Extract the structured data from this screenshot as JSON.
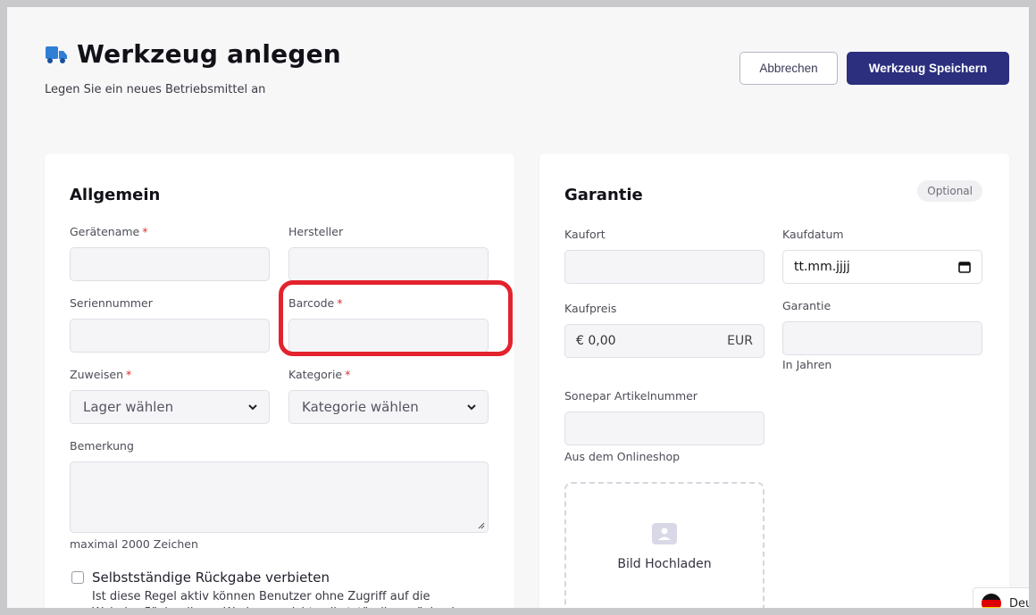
{
  "header": {
    "title": "Werkzeug anlegen",
    "subtitle": "Legen Sie ein neues Betriebsmittel an",
    "cancel_label": "Abbrechen",
    "save_label": "Werkzeug Speichern",
    "accent_color": "#2b2f7d",
    "icon": "truck-icon"
  },
  "general": {
    "title": "Allgemein",
    "device_name_label": "Gerätename",
    "manufacturer_label": "Hersteller",
    "serial_label": "Seriennummer",
    "barcode_label": "Barcode",
    "assign_label": "Zuweisen",
    "assign_value": "Lager wählen",
    "category_label": "Kategorie",
    "category_value": "Kategorie wählen",
    "remark_label": "Bemerkung",
    "remark_hint": "maximal 2000 Zeichen",
    "required_mark": "*",
    "highlight_color": "#e2232d",
    "return_checkbox_label": "Selbstständige Rückgabe verbieten",
    "return_checkbox_desc": "Ist diese Regel aktiv können Benutzer ohne Zugriff auf die Weboberfläche dieses Werkzeug nicht selbstständig zurückgeben"
  },
  "warranty": {
    "title": "Garantie",
    "badge": "Optional",
    "place_label": "Kaufort",
    "date_label": "Kaufdatum",
    "date_placeholder": "tt.mm.jjjj",
    "price_label": "Kaufpreis",
    "price_value": "€ 0,00",
    "price_currency": "EUR",
    "warranty_label": "Garantie",
    "warranty_hint": "In Jahren",
    "article_label": "Sonepar Artikelnummer",
    "article_hint": "Aus dem Onlineshop",
    "upload_label": "Bild Hochladen"
  },
  "language": {
    "label": "Deut",
    "flag": "germany-flag-icon"
  }
}
